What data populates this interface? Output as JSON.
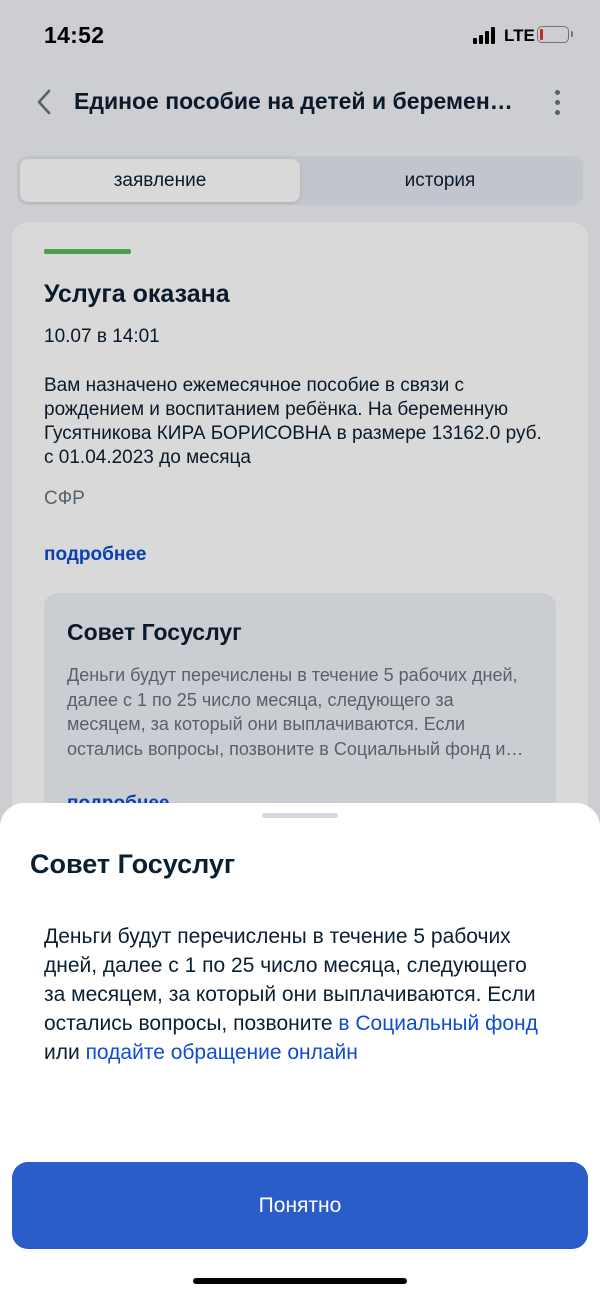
{
  "status_bar": {
    "time": "14:52",
    "network": "LTE",
    "battery_color": "#e5312a"
  },
  "header": {
    "title": "Единое пособие на детей и беременных",
    "back_icon": "chevron-left-icon",
    "menu_icon": "more-vertical-icon"
  },
  "tabs": [
    {
      "label": "заявление",
      "active": true
    },
    {
      "label": "история",
      "active": false
    }
  ],
  "status_card": {
    "accent_color": "#5cb85c",
    "title": "Услуга оказана",
    "date": "10.07 в 14:01",
    "text": "Вам назначено ежемесячное пособие в связи с рождением и воспитанием ребёнка. На беременную Гусятникова КИРА БОРИСОВНА в размере 13162.0 руб. с 01.04.2023 до месяца",
    "source": "СФР",
    "more_link": "подробнее",
    "tip": {
      "title": "Совет Госуслуг",
      "text": "Деньги будут перечислены в течение 5 рабочих дней, далее с 1 по 25 число месяца, следующего за месяцем, за который они выплачиваются. Если остались вопросы, позвоните в Социальный фонд или подайте обращение онлайн",
      "more_link": "подробнее"
    }
  },
  "sheet": {
    "title": "Совет Госуслуг",
    "text_part1": "Деньги будут перечислены в течение 5 рабочих дней, далее с 1 по 25 число месяца, следующего за месяцем, за который они выплачиваются. Если остались вопросы, позвоните ",
    "link1": "в Социальный фонд",
    "text_part2": " или ",
    "link2": "подайте обращение онлайн",
    "button_label": "Понятно",
    "button_color": "#2b5dc8",
    "link_color": "#0d4cd3"
  }
}
